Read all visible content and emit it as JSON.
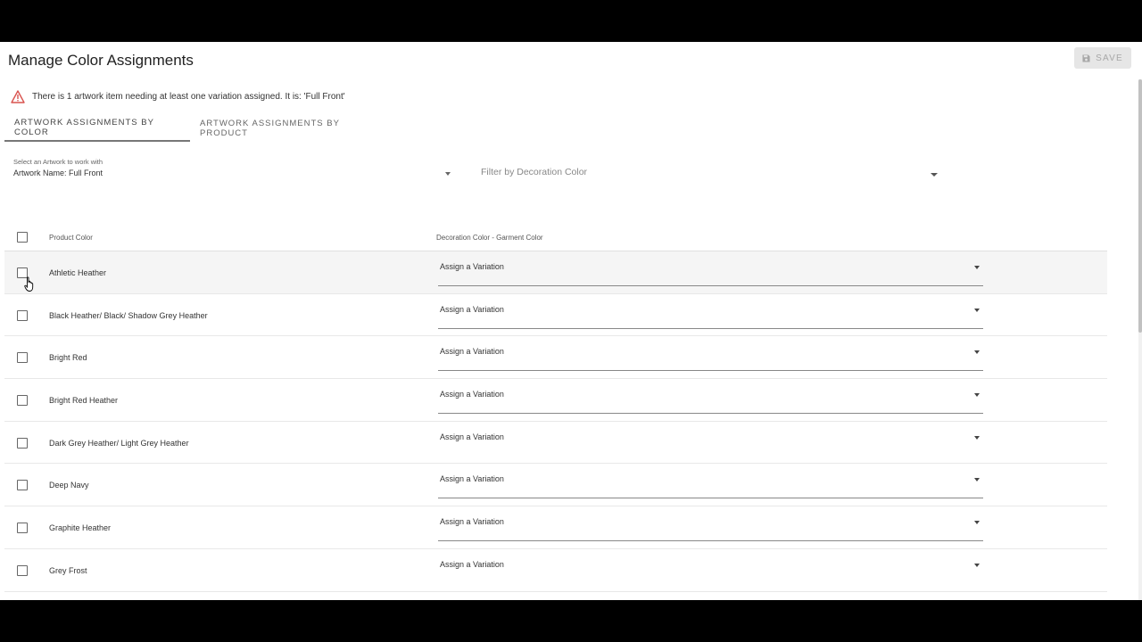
{
  "page": {
    "title": "Manage Color Assignments",
    "save_label": "SAVE"
  },
  "warning": {
    "text": "There is 1 artwork item needing at least one variation assigned. It is: 'Full Front'",
    "icon": "warning-triangle-icon",
    "color": "#d9534f"
  },
  "tabs": [
    {
      "label": "ARTWORK ASSIGNMENTS BY COLOR",
      "active": true
    },
    {
      "label": "ARTWORK ASSIGNMENTS BY PRODUCT",
      "active": false
    }
  ],
  "artwork_select": {
    "label": "Select an Artwork to work with",
    "value": "Artwork Name: Full Front"
  },
  "filter_select": {
    "placeholder": "Filter by Decoration Color"
  },
  "table": {
    "headers": {
      "product_color": "Product Color",
      "decoration_color": "Decoration Color - Garment Color"
    },
    "rows": [
      {
        "product_color": "Athletic Heather",
        "assignment": "Assign a Variation"
      },
      {
        "product_color": "Black Heather/ Black/ Shadow Grey Heather",
        "assignment": "Assign a Variation"
      },
      {
        "product_color": "Bright Red",
        "assignment": "Assign a Variation"
      },
      {
        "product_color": "Bright Red Heather",
        "assignment": "Assign a Variation"
      },
      {
        "product_color": "Dark Grey Heather/ Light Grey Heather",
        "assignment": "Assign a Variation"
      },
      {
        "product_color": "Deep Navy",
        "assignment": "Assign a Variation"
      },
      {
        "product_color": "Graphite Heather",
        "assignment": "Assign a Variation"
      },
      {
        "product_color": "Grey Frost",
        "assignment": "Assign a Variation"
      }
    ]
  }
}
